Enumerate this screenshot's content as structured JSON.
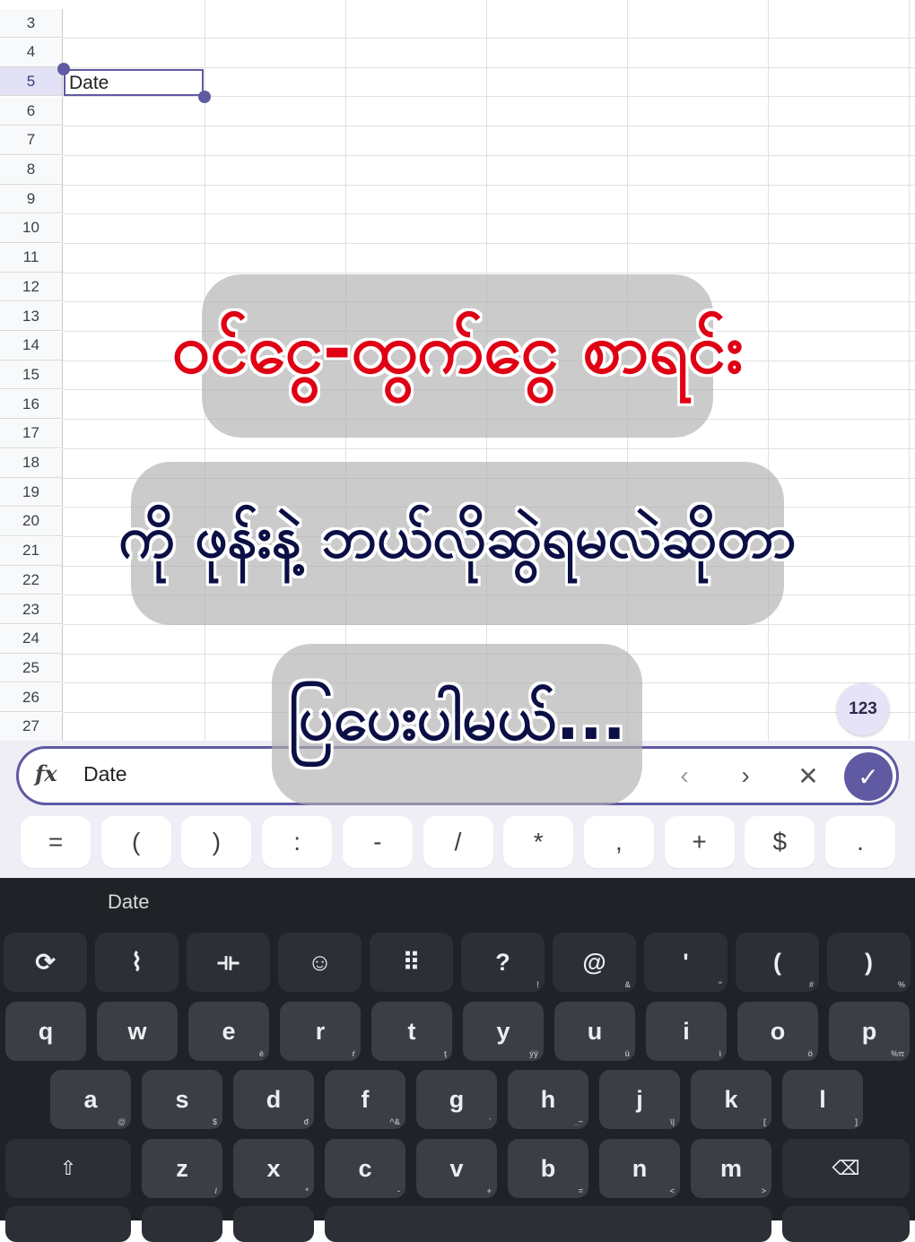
{
  "sheet": {
    "rows": [
      "3",
      "4",
      "5",
      "6",
      "7",
      "8",
      "9",
      "10",
      "11",
      "12",
      "13",
      "14",
      "15",
      "16",
      "17",
      "18",
      "19",
      "20",
      "21",
      "22",
      "23",
      "24",
      "25",
      "26",
      "27"
    ],
    "selected_row": "5",
    "selected_cell_value": "Date"
  },
  "captions": {
    "line1": "ဝင်ငွေ-ထွက်ငွေ စာရင်း",
    "line2": "ကို ဖုန်းနဲ့ ဘယ်လိုဆွဲရမလဲဆိုတာ",
    "line3": "ပြပေးပါမယ်..."
  },
  "badge_123": "123",
  "formula_bar": {
    "fx_icon": "fx",
    "value": "Date",
    "prev": "‹",
    "next": "›",
    "clear": "✕",
    "confirm": "✓"
  },
  "operators": [
    "=",
    "(",
    ")",
    ":",
    "-",
    "/",
    "*",
    ",",
    "+",
    "$",
    "."
  ],
  "keyboard": {
    "suggestion": "Date",
    "fn_row": [
      {
        "label": "⟳",
        "icon": "rotate-icon",
        "hint": ""
      },
      {
        "label": "⌇",
        "icon": "sticker-icon",
        "hint": ""
      },
      {
        "label": "⟛",
        "icon": "cursor-move-icon",
        "hint": ""
      },
      {
        "label": "☺",
        "icon": "emoji-icon",
        "hint": ""
      },
      {
        "label": "⠿",
        "icon": "numpad-icon",
        "hint": ""
      },
      {
        "label": "?",
        "icon": "",
        "hint": "!"
      },
      {
        "label": "@",
        "icon": "",
        "hint": "&"
      },
      {
        "label": "'",
        "icon": "",
        "hint": "\""
      },
      {
        "label": "(",
        "icon": "",
        "hint": "#"
      },
      {
        "label": ")",
        "icon": "",
        "hint": "%"
      }
    ],
    "row1": [
      {
        "label": "q",
        "hint": ""
      },
      {
        "label": "w",
        "hint": ""
      },
      {
        "label": "e",
        "hint": "è"
      },
      {
        "label": "r",
        "hint": "ŕ"
      },
      {
        "label": "t",
        "hint": "ţ"
      },
      {
        "label": "y",
        "hint": "ýÿ"
      },
      {
        "label": "u",
        "hint": "ü"
      },
      {
        "label": "i",
        "hint": "ì"
      },
      {
        "label": "o",
        "hint": "ö"
      },
      {
        "label": "p",
        "hint": "%π"
      }
    ],
    "row2": [
      {
        "label": "a",
        "hint": "@"
      },
      {
        "label": "s",
        "hint": "$"
      },
      {
        "label": "d",
        "hint": "đ"
      },
      {
        "label": "f",
        "hint": "^&"
      },
      {
        "label": "g",
        "hint": "`"
      },
      {
        "label": "h",
        "hint": "_~"
      },
      {
        "label": "j",
        "hint": "\\|"
      },
      {
        "label": "k",
        "hint": "["
      },
      {
        "label": "l",
        "hint": "]"
      }
    ],
    "row3": [
      {
        "label": "z",
        "hint": "/"
      },
      {
        "label": "x",
        "hint": "*"
      },
      {
        "label": "c",
        "hint": "-"
      },
      {
        "label": "v",
        "hint": "+"
      },
      {
        "label": "b",
        "hint": "="
      },
      {
        "label": "n",
        "hint": "<"
      },
      {
        "label": "m",
        "hint": ">"
      }
    ],
    "shift": "⇧",
    "backspace": "⌫"
  }
}
